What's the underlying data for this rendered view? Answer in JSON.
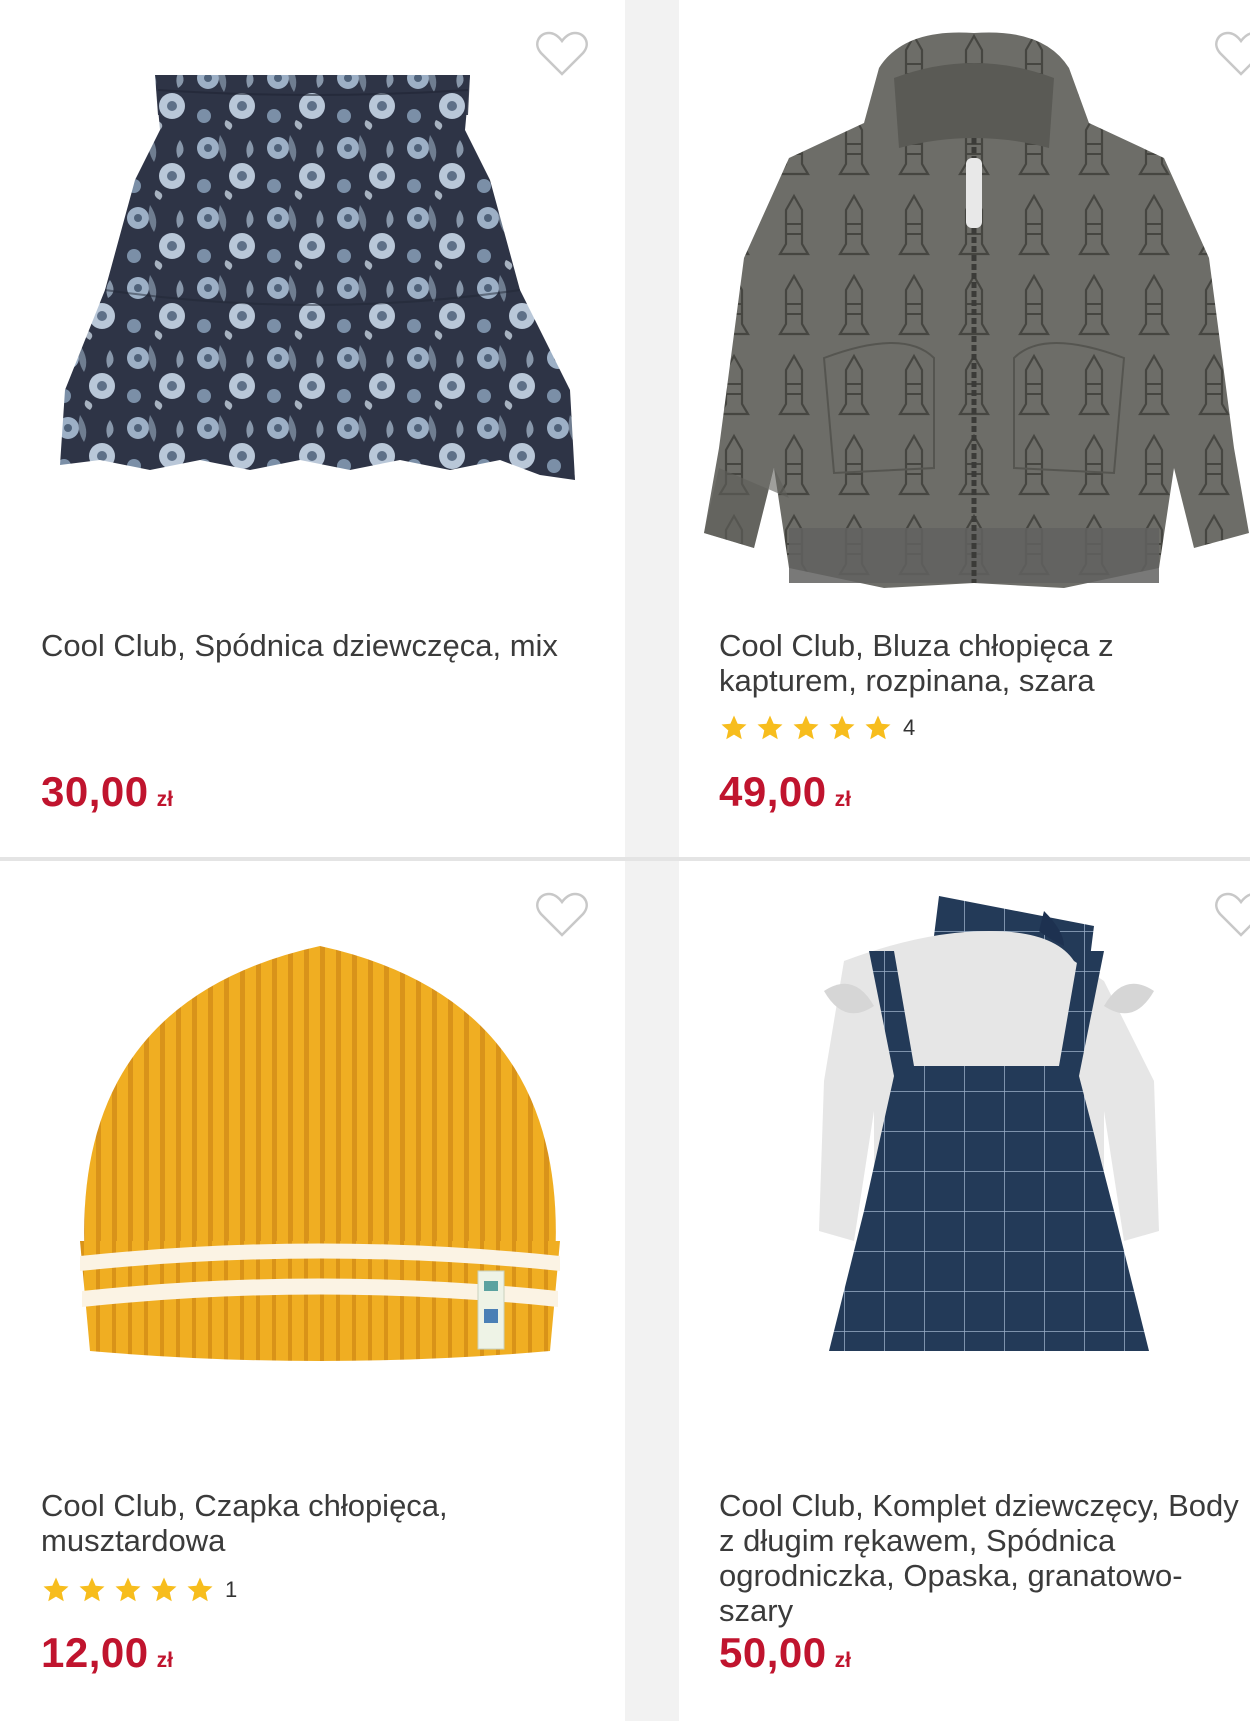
{
  "products": [
    {
      "title": "Cool Club, Spódnica dziewczęca, mix",
      "image": "floral-skirt",
      "price": "30,00",
      "currency": "zł",
      "favorite_icon": "heart-outline-icon"
    },
    {
      "title": "Cool Club, Bluza chłopięca z kapturem, rozpinana, szara",
      "image": "grey-zip-hoodie-rockets",
      "rating_count": "4",
      "price": "49,00",
      "currency": "zł",
      "favorite_icon": "heart-outline-icon"
    },
    {
      "title": "Cool Club, Czapka chłopięca, musztardowa",
      "image": "mustard-beanie",
      "rating_count": "1",
      "price": "12,00",
      "currency": "zł",
      "favorite_icon": "heart-outline-icon"
    },
    {
      "title": "Cool Club, Komplet dziewczęcy, Body z długim rękawem, Spódnica ogrodniczka, Opaska, granatowo-szary",
      "image": "navy-pinafore-set",
      "price": "50,00",
      "currency": "zł",
      "favorite_icon": "heart-outline-icon"
    }
  ],
  "colors": {
    "price": "#c0142e",
    "star": "#f7bd1d",
    "heart_outline": "#c8c8c8"
  }
}
